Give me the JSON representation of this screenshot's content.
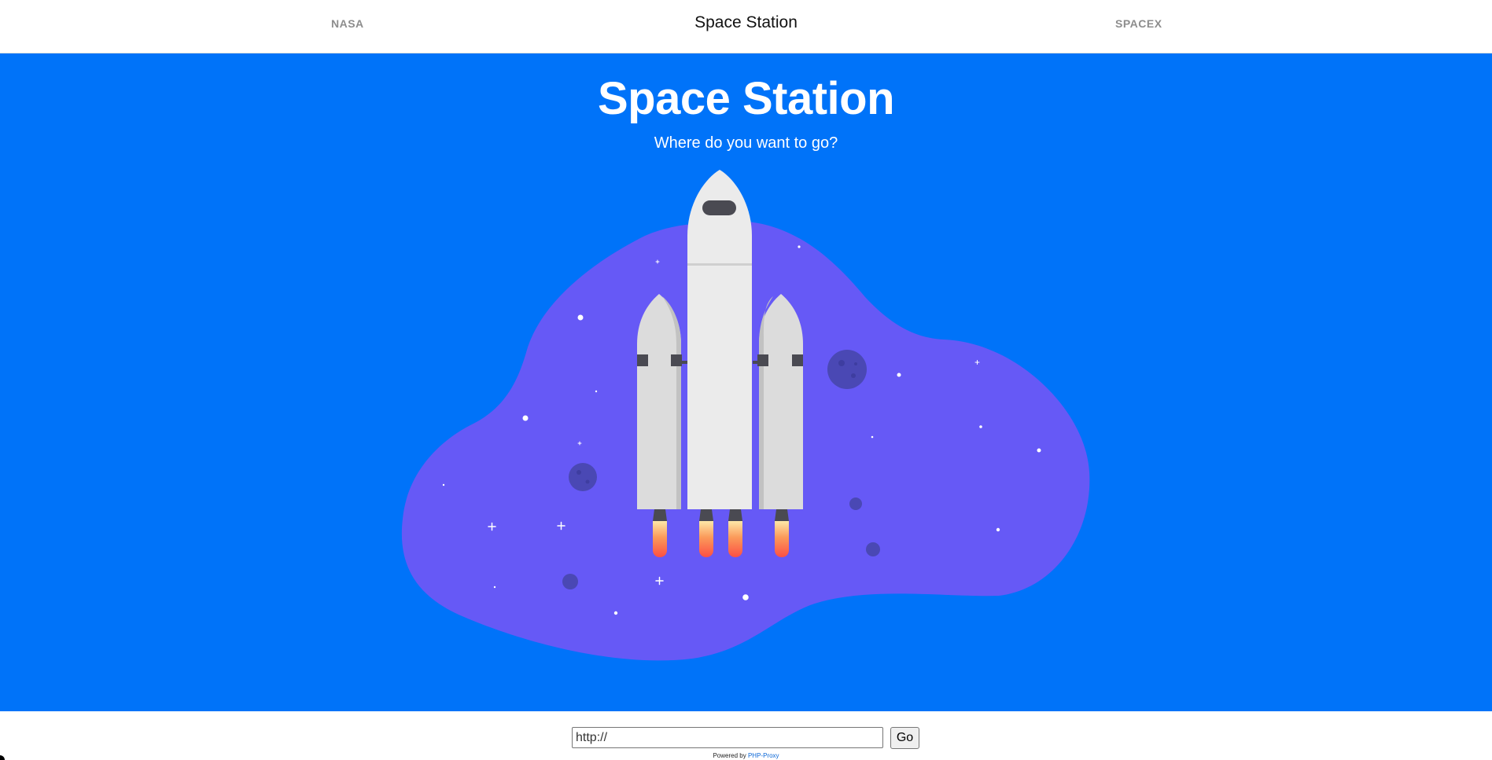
{
  "nav": {
    "left_link": "NASA",
    "title": "Space Station",
    "right_link": "SPACEX"
  },
  "hero": {
    "title": "Space Station",
    "subtitle": "Where do you want to go?",
    "illustration": "rocket-launch-illustration"
  },
  "form": {
    "url_value": "http://",
    "go_label": "Go"
  },
  "footer": {
    "powered_prefix": "Powered by",
    "powered_link": "PHP-Proxy"
  },
  "colors": {
    "hero_bg": "#0073f9",
    "blob": "#6659f6",
    "planet": "#4a48b4",
    "rocket_body": "#ebebeb",
    "rocket_dark": "#4a4a52",
    "flame_top": "#fde8a8",
    "flame_bottom": "#fc4f44",
    "link": "#0a66d6"
  }
}
